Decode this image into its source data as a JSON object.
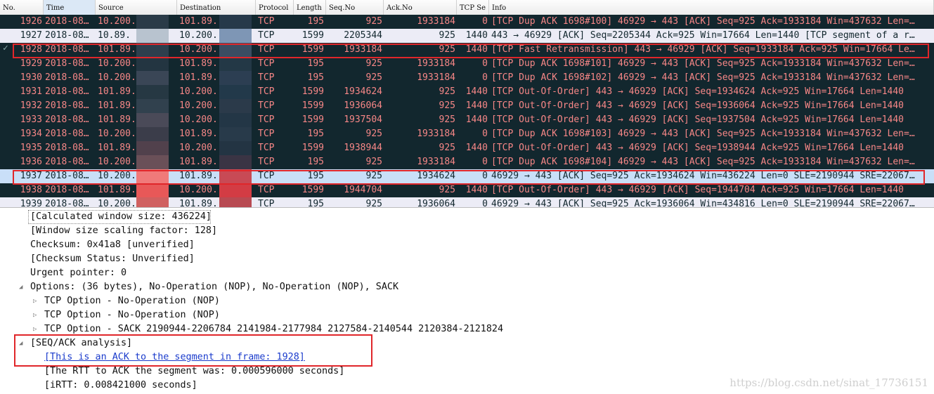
{
  "columns": [
    "No.",
    "Time",
    "Source",
    "Destination",
    "Protocol",
    "Length",
    "Seq.No",
    "Ack.No",
    "TCP Se",
    "Info"
  ],
  "packets": [
    {
      "no": "1926",
      "time": "2018-08…",
      "src": "10.200.",
      "dst": "101.89.",
      "proto": "TCP",
      "len": "195",
      "seq": "925",
      "ack": "1933184",
      "tcpse": "0",
      "info": "[TCP Dup ACK 1698#100] 46929 → 443 [ACK] Seq=925 Ack=1933184 Win=437632 Len=…"
    },
    {
      "no": "1927",
      "time": "2018-08…",
      "src": "10.89.",
      "dst": "10.200.",
      "proto": "TCP",
      "len": "1599",
      "seq": "2205344",
      "ack": "925",
      "tcpse": "1440",
      "info": "443 → 46929 [ACK] Seq=2205344 Ack=925 Win=17664 Len=1440 [TCP segment of a r…"
    },
    {
      "no": "1928",
      "time": "2018-08…",
      "src": "101.89.",
      "dst": "10.200.",
      "proto": "TCP",
      "len": "1599",
      "seq": "1933184",
      "ack": "925",
      "tcpse": "1440",
      "info": "[TCP Fast Retransmission] 443 → 46929 [ACK] Seq=1933184 Ack=925 Win=17664 Le…"
    },
    {
      "no": "1929",
      "time": "2018-08…",
      "src": "10.200.",
      "dst": "101.89.",
      "proto": "TCP",
      "len": "195",
      "seq": "925",
      "ack": "1933184",
      "tcpse": "0",
      "info": "[TCP Dup ACK 1698#101] 46929 → 443 [ACK] Seq=925 Ack=1933184 Win=437632 Len=…"
    },
    {
      "no": "1930",
      "time": "2018-08…",
      "src": "10.200.",
      "dst": "101.89.",
      "proto": "TCP",
      "len": "195",
      "seq": "925",
      "ack": "1933184",
      "tcpse": "0",
      "info": "[TCP Dup ACK 1698#102] 46929 → 443 [ACK] Seq=925 Ack=1933184 Win=437632 Len=…"
    },
    {
      "no": "1931",
      "time": "2018-08…",
      "src": "101.89.",
      "dst": "10.200.",
      "proto": "TCP",
      "len": "1599",
      "seq": "1934624",
      "ack": "925",
      "tcpse": "1440",
      "info": "[TCP Out-Of-Order] 443 → 46929 [ACK] Seq=1934624 Ack=925 Win=17664 Len=1440"
    },
    {
      "no": "1932",
      "time": "2018-08…",
      "src": "101.89.",
      "dst": "10.200.",
      "proto": "TCP",
      "len": "1599",
      "seq": "1936064",
      "ack": "925",
      "tcpse": "1440",
      "info": "[TCP Out-Of-Order] 443 → 46929 [ACK] Seq=1936064 Ack=925 Win=17664 Len=1440"
    },
    {
      "no": "1933",
      "time": "2018-08…",
      "src": "101.89.",
      "dst": "10.200.",
      "proto": "TCP",
      "len": "1599",
      "seq": "1937504",
      "ack": "925",
      "tcpse": "1440",
      "info": "[TCP Out-Of-Order] 443 → 46929 [ACK] Seq=1937504 Ack=925 Win=17664 Len=1440"
    },
    {
      "no": "1934",
      "time": "2018-08…",
      "src": "10.200.",
      "dst": "101.89.",
      "proto": "TCP",
      "len": "195",
      "seq": "925",
      "ack": "1933184",
      "tcpse": "0",
      "info": "[TCP Dup ACK 1698#103] 46929 → 443 [ACK] Seq=925 Ack=1933184 Win=437632 Len=…"
    },
    {
      "no": "1935",
      "time": "2018-08…",
      "src": "101.89.",
      "dst": "10.200.",
      "proto": "TCP",
      "len": "1599",
      "seq": "1938944",
      "ack": "925",
      "tcpse": "1440",
      "info": "[TCP Out-Of-Order] 443 → 46929 [ACK] Seq=1938944 Ack=925 Win=17664 Len=1440"
    },
    {
      "no": "1936",
      "time": "2018-08…",
      "src": "10.200.",
      "dst": "101.89.",
      "proto": "TCP",
      "len": "195",
      "seq": "925",
      "ack": "1933184",
      "tcpse": "0",
      "info": "[TCP Dup ACK 1698#104] 46929 → 443 [ACK] Seq=925 Ack=1933184 Win=437632 Len=…"
    },
    {
      "no": "1937",
      "time": "2018-08…",
      "src": "10.200.",
      "dst": "101.89.",
      "proto": "TCP",
      "len": "195",
      "seq": "925",
      "ack": "1934624",
      "tcpse": "0",
      "info": "46929 → 443 [ACK] Seq=925 Ack=1934624 Win=436224 Len=0 SLE=2190944 SRE=22067…"
    },
    {
      "no": "1938",
      "time": "2018-08…",
      "src": "101.89.",
      "dst": "10.200.",
      "proto": "TCP",
      "len": "1599",
      "seq": "1944704",
      "ack": "925",
      "tcpse": "1440",
      "info": "[TCP Out-Of-Order] 443 → 46929 [ACK] Seq=1944704 Ack=925 Win=17664 Len=1440"
    },
    {
      "no": "1939",
      "time": "2018-08…",
      "src": "10.200.",
      "dst": "101.89.",
      "proto": "TCP",
      "len": "195",
      "seq": "925",
      "ack": "1936064",
      "tcpse": "0",
      "info": "46929 → 443 [ACK] Seq=925 Ack=1936064 Win=434816 Len=0 SLE=2190944 SRE=22067…"
    }
  ],
  "row_styles": [
    "dark",
    "light",
    "dark",
    "dark",
    "dark",
    "dark",
    "dark",
    "dark",
    "dark",
    "dark",
    "dark",
    "sel",
    "dark",
    "light"
  ],
  "details": [
    {
      "text": "[Calculated window size: 436224]"
    },
    {
      "text": "[Window size scaling factor: 128]"
    },
    {
      "text": "Checksum: 0x41a8 [unverified]"
    },
    {
      "text": "[Checksum Status: Unverified]"
    },
    {
      "text": "Urgent pointer: 0"
    },
    {
      "text": "Options: (36 bytes), No-Operation (NOP), No-Operation (NOP), SACK"
    },
    {
      "text": "TCP Option - No-Operation (NOP)"
    },
    {
      "text": "TCP Option - No-Operation (NOP)"
    },
    {
      "text": "TCP Option - SACK 2190944-2206784 2141984-2177984 2127584-2140544 2120384-2121824"
    },
    {
      "text": "[SEQ/ACK analysis]"
    },
    {
      "text": "[This is an ACK to the segment in frame: 1928]"
    },
    {
      "text": "[The RTT to ACK the segment was: 0.000596000 seconds]"
    },
    {
      "text": "[iRTT: 0.008421000 seconds]"
    }
  ],
  "watermark": "https://blog.csdn.net/sinat_17736151",
  "colors": {
    "dark_row_bg": "#12272e",
    "dark_row_fg": "#f78787",
    "highlight_box": "#e0262a",
    "link": "#1a3bcc"
  }
}
